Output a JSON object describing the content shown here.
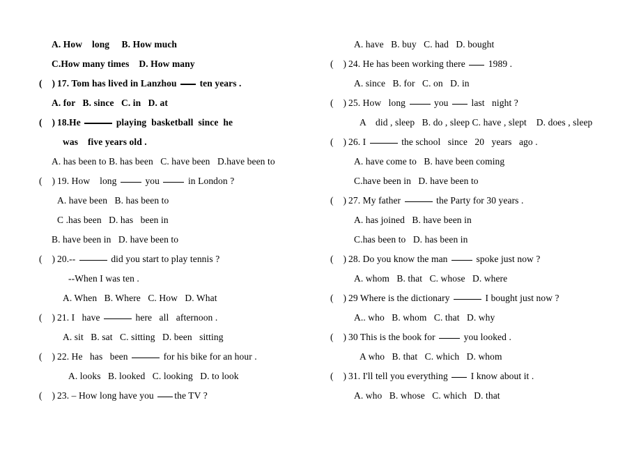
{
  "document": {
    "type": "english-grammar-multiple-choice-worksheet",
    "background_color": "#ffffff",
    "text_color": "#000000"
  },
  "left_column": {
    "lines": [
      {
        "id": "l1",
        "kind": "options",
        "bold": true,
        "indent": 2,
        "paren": false,
        "text": "A. How    long     B. How much"
      },
      {
        "id": "l2",
        "kind": "options",
        "bold": true,
        "indent": 2,
        "paren": false,
        "text": "C.How many times    D. How many"
      },
      {
        "id": "l3",
        "kind": "question",
        "bold": true,
        "indent": 0,
        "paren": true,
        "text": "17. Tom has lived in Lanzhou ___ ten years ."
      },
      {
        "id": "l4",
        "kind": "options",
        "bold": true,
        "indent": 2,
        "paren": false,
        "text": "A. for   B. since   C. in   D. at"
      },
      {
        "id": "l5",
        "kind": "question",
        "bold": true,
        "indent": 0,
        "paren": true,
        "text": "18.He _____ playing  basketball  since  he"
      },
      {
        "id": "l6",
        "kind": "question-cont",
        "bold": true,
        "indent": 4,
        "paren": false,
        "text": "was    five years old ."
      },
      {
        "id": "l7",
        "kind": "options",
        "bold": false,
        "indent": 2,
        "paren": false,
        "text": "A. has been to B. has been   C. have been   D.have been to"
      },
      {
        "id": "l8",
        "kind": "question",
        "bold": false,
        "indent": 0,
        "paren": true,
        "text": "19. How    long ____ you ____ in London ?"
      },
      {
        "id": "l9",
        "kind": "options",
        "bold": false,
        "indent": 3,
        "paren": false,
        "text": "A. have been   B. has been to"
      },
      {
        "id": "l10",
        "kind": "options",
        "bold": false,
        "indent": 3,
        "paren": false,
        "text": "C .has been   D. has   been in"
      },
      {
        "id": "l11",
        "kind": "options",
        "bold": false,
        "indent": 2,
        "paren": false,
        "text": "B. have been in   D. have been to"
      },
      {
        "id": "l12",
        "kind": "question",
        "bold": false,
        "indent": 0,
        "paren": true,
        "text": "20.-- _____ did you start to play tennis ?"
      },
      {
        "id": "l13",
        "kind": "question-cont",
        "bold": false,
        "indent": 5,
        "paren": false,
        "text": "--When I was ten ."
      },
      {
        "id": "l14",
        "kind": "options",
        "bold": false,
        "indent": 4,
        "paren": false,
        "text": "A. When   B. Where   C. How   D. What"
      },
      {
        "id": "l15",
        "kind": "question",
        "bold": false,
        "indent": 0,
        "paren": true,
        "text": "21. I   have _____ here   all   afternoon ."
      },
      {
        "id": "l16",
        "kind": "options",
        "bold": false,
        "indent": 4,
        "paren": false,
        "text": "A. sit   B. sat   C. sitting   D. been   sitting"
      },
      {
        "id": "l17",
        "kind": "question",
        "bold": false,
        "indent": 0,
        "paren": true,
        "text": "22. He   has   been _____ for his bike for an hour ."
      },
      {
        "id": "l18",
        "kind": "options",
        "bold": false,
        "indent": 5,
        "paren": false,
        "text": "A. looks   B. looked   C. looking   D. to look"
      },
      {
        "id": "l19",
        "kind": "question",
        "bold": false,
        "indent": 0,
        "paren": true,
        "text": "23. – How long have you ___the TV ?"
      }
    ]
  },
  "right_column": {
    "lines": [
      {
        "id": "r1",
        "kind": "options",
        "bold": false,
        "indent": 4,
        "paren": false,
        "text": "A. have   B. buy   C. had   D. bought"
      },
      {
        "id": "r2",
        "kind": "question",
        "bold": false,
        "indent": 0,
        "paren": true,
        "text": "24. He has been working there ___ 1989 ."
      },
      {
        "id": "r3",
        "kind": "options",
        "bold": false,
        "indent": 4,
        "paren": false,
        "text": "A. since   B. for   C. on   D. in"
      },
      {
        "id": "r4",
        "kind": "question",
        "bold": false,
        "indent": 0,
        "paren": true,
        "text": "25. How   long ____ you ___ last   night ?"
      },
      {
        "id": "r5",
        "kind": "options",
        "bold": false,
        "indent": 5,
        "paren": false,
        "text": "A    did , sleep   B. do , sleep C. have , slept    D. does , sleep"
      },
      {
        "id": "r6",
        "kind": "question",
        "bold": false,
        "indent": 0,
        "paren": true,
        "text": "26. I _____ the school   since   20   years   ago ."
      },
      {
        "id": "r7",
        "kind": "options",
        "bold": false,
        "indent": 4,
        "paren": false,
        "text": "A. have come to   B. have been coming"
      },
      {
        "id": "r8",
        "kind": "options",
        "bold": false,
        "indent": 4,
        "paren": false,
        "text": "C.have been in   D. have been to"
      },
      {
        "id": "r9",
        "kind": "question",
        "bold": false,
        "indent": 0,
        "paren": true,
        "text": "27. My father _____ the Party for 30 years ."
      },
      {
        "id": "r10",
        "kind": "options",
        "bold": false,
        "indent": 4,
        "paren": false,
        "text": "A. has joined   B. have been in"
      },
      {
        "id": "r11",
        "kind": "options",
        "bold": false,
        "indent": 4,
        "paren": false,
        "text": "C.has been to   D. has been in"
      },
      {
        "id": "r12",
        "kind": "question",
        "bold": false,
        "indent": 0,
        "paren": true,
        "text": "28. Do you know the man ____ spoke just now ?"
      },
      {
        "id": "r13",
        "kind": "options",
        "bold": false,
        "indent": 4,
        "paren": false,
        "text": "A. whom   B. that   C. whose   D. where"
      },
      {
        "id": "r14",
        "kind": "question",
        "bold": false,
        "indent": 0,
        "paren": true,
        "text": "29 Where is the dictionary _____ I bought just now ?"
      },
      {
        "id": "r15",
        "kind": "options",
        "bold": false,
        "indent": 4,
        "paren": false,
        "text": "A.. who   B. whom   C. that   D. why"
      },
      {
        "id": "r16",
        "kind": "question",
        "bold": false,
        "indent": 0,
        "paren": true,
        "text": "30 This is the book for ____ you looked ."
      },
      {
        "id": "r17",
        "kind": "options",
        "bold": false,
        "indent": 5,
        "paren": false,
        "text": "A who   B. that   C. which   D. whom"
      },
      {
        "id": "r18",
        "kind": "question",
        "bold": false,
        "indent": 0,
        "paren": true,
        "text": "31. I'll tell you everything ___ I know about it ."
      },
      {
        "id": "r19",
        "kind": "options",
        "bold": false,
        "indent": 4,
        "paren": false,
        "text": "A. who   B. whose   C. which   D. that"
      }
    ]
  },
  "markers": {
    "open_paren": "(",
    "close_paren": ")"
  }
}
